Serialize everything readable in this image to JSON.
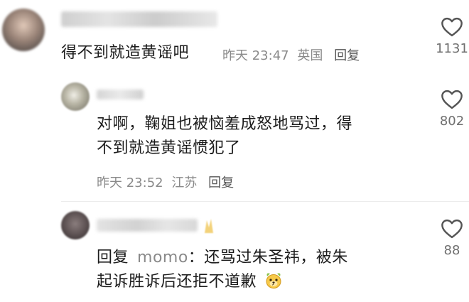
{
  "comments": [
    {
      "text": "得不到就造黄谣吧",
      "time": "昨天 23:47",
      "location": "英国",
      "reply_label": "回复",
      "likes": "1131"
    },
    {
      "text_line1": "对啊，鞠姐也被恼羞成怒地骂过，得",
      "text_line2": "不到就造黄谣惯犯了",
      "time": "昨天 23:52",
      "location": "江苏",
      "reply_label": "回复",
      "likes": "802"
    },
    {
      "reply_prefix": "回复",
      "mention": "momo",
      "text_line1_rest": "：还骂过朱圣祎，被朱",
      "text_line2": "起诉胜诉后还拒不道歉",
      "likes": "88"
    }
  ],
  "colors": {
    "text": "#1c1c1c",
    "meta": "#8a8a8a",
    "like_icon": "#555555"
  }
}
